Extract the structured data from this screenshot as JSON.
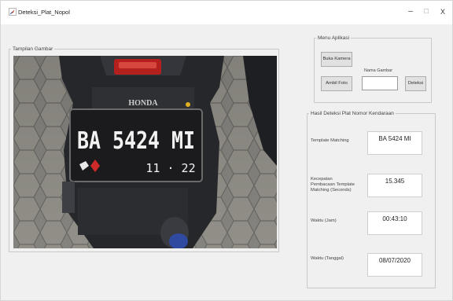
{
  "window": {
    "title": "Deteksi_Plat_Nopol",
    "minimize_glyph": "–",
    "maximize_glyph": "☐",
    "close_glyph": "X"
  },
  "tampilan": {
    "legend": "Tampilan Gambar",
    "photo": {
      "brand": "HONDA",
      "plate_number": "BA 5424 MI",
      "plate_date": "11 · 22"
    }
  },
  "menu": {
    "legend": "Menu Aplikasi",
    "buka_kamera": "Buka Kamera",
    "ambil_foto": "Ambil Foto",
    "nama_gambar_label": "Nama Gambar",
    "nama_gambar_value": "",
    "deteksi": "Deteksi"
  },
  "hasil": {
    "legend": "Hasil Deteksi Plat Nomor Kendaraan",
    "template_matching_label": "Template Matching",
    "template_matching_value": "BA 5424 MI",
    "kecepatan_label": "Kecepatan Pembacaan Template Matching (Seconds)",
    "kecepatan_value": "15.345",
    "waktu_jam_label": "Waktu (Jam)",
    "waktu_jam_value": "00:43:10",
    "waktu_tanggal_label": "Waktu (Tanggal)",
    "waktu_tanggal_value": "08/07/2020"
  },
  "colors": {
    "plate_bg": "#1b1b1d",
    "plate_text": "#f2f2f2",
    "motorcycle_body": "#26282c",
    "pavement": "#8e8c88"
  },
  "icons": {
    "app": "feather-app-icon",
    "plate_logo": "sticker-icon"
  }
}
